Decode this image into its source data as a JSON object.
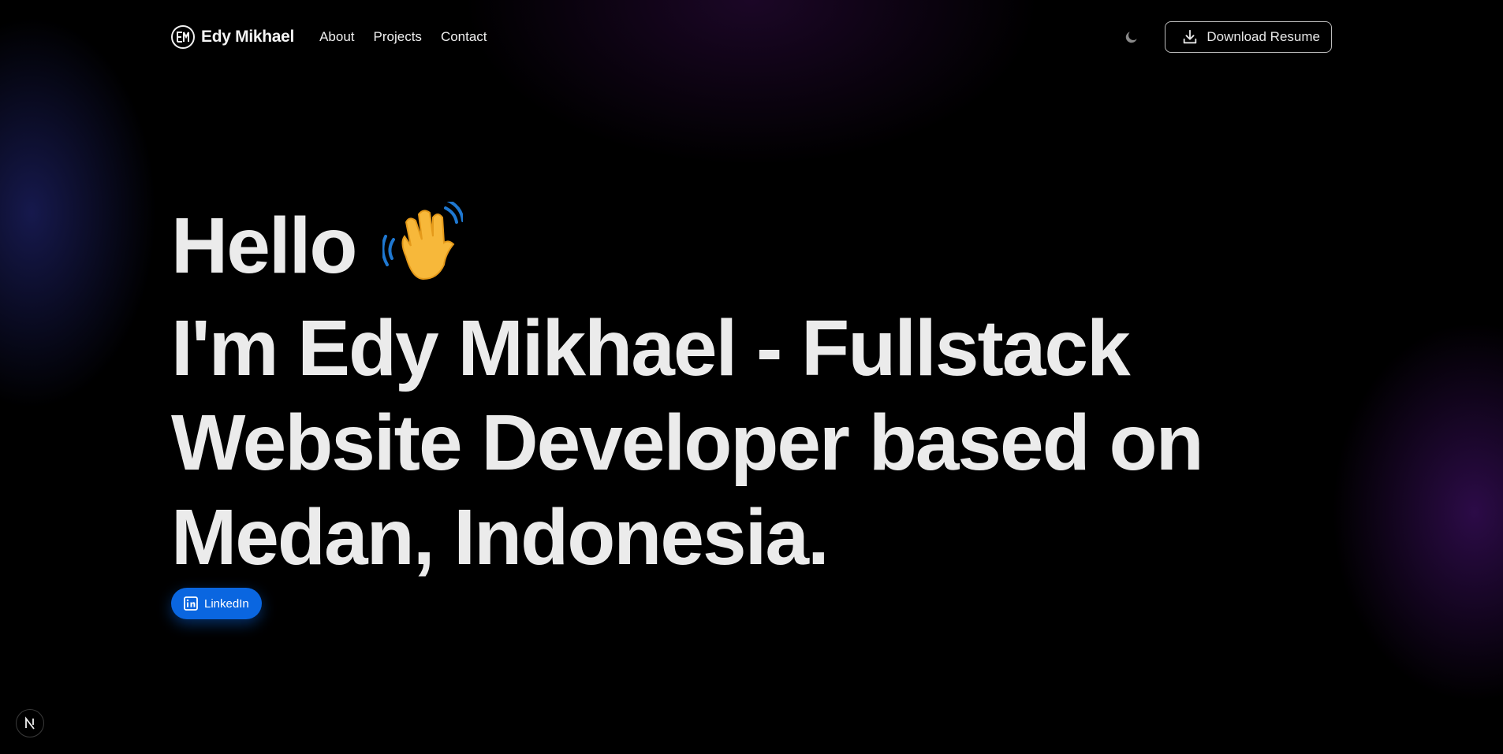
{
  "header": {
    "brand_name": "Edy Mikhael",
    "logo_icon": "em-monogram-logo",
    "nav_links": [
      "About",
      "Projects",
      "Contact"
    ],
    "theme_toggle_icon": "moon-icon",
    "download_button": {
      "icon": "download-icon",
      "label": "Download Resume"
    }
  },
  "hero": {
    "greeting": "Hello",
    "greeting_emoji": "waving-hand-icon",
    "lines": [
      "I'm Edy Mikhael - Fullstack",
      "Website Developer based on",
      "Medan, Indonesia."
    ]
  },
  "social": {
    "linkedin": {
      "icon": "linkedin-icon",
      "label": "LinkedIn",
      "color": "#0a66e0"
    }
  },
  "dev_badge": {
    "icon": "nextjs-icon"
  },
  "colors": {
    "background": "#000000",
    "text": "#ebebeb",
    "accent": "#0a66e0"
  }
}
